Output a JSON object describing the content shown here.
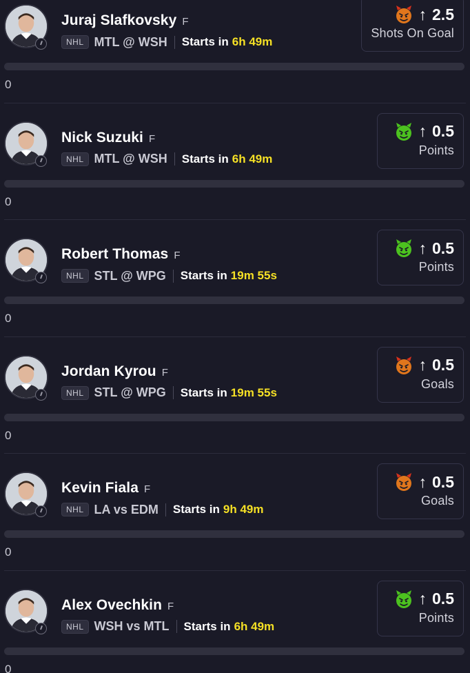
{
  "props": [
    {
      "player": "Juraj Slafkovsky",
      "position": "F",
      "league": "NHL",
      "matchup": "MTL @ WSH",
      "starts_label": "Starts in",
      "countdown": "6h 49m",
      "direction_icon": "arrow-up-icon",
      "line": "2.5",
      "stat": "Shots On Goal",
      "face": "devil-red-icon",
      "progress": 0,
      "progress_text": "0"
    },
    {
      "player": "Nick Suzuki",
      "position": "F",
      "league": "NHL",
      "matchup": "MTL @ WSH",
      "starts_label": "Starts in",
      "countdown": "6h 49m",
      "direction_icon": "arrow-up-icon",
      "line": "0.5",
      "stat": "Points",
      "face": "devil-green-icon",
      "progress": 0,
      "progress_text": "0"
    },
    {
      "player": "Robert Thomas",
      "position": "F",
      "league": "NHL",
      "matchup": "STL @ WPG",
      "starts_label": "Starts in",
      "countdown": "19m 55s",
      "direction_icon": "arrow-up-icon",
      "line": "0.5",
      "stat": "Points",
      "face": "devil-green-icon",
      "progress": 0,
      "progress_text": "0"
    },
    {
      "player": "Jordan Kyrou",
      "position": "F",
      "league": "NHL",
      "matchup": "STL @ WPG",
      "starts_label": "Starts in",
      "countdown": "19m 55s",
      "direction_icon": "arrow-up-icon",
      "line": "0.5",
      "stat": "Goals",
      "face": "devil-red-icon",
      "progress": 0,
      "progress_text": "0"
    },
    {
      "player": "Kevin Fiala",
      "position": "F",
      "league": "NHL",
      "matchup": "LA vs EDM",
      "starts_label": "Starts in",
      "countdown": "9h 49m",
      "direction_icon": "arrow-up-icon",
      "line": "0.5",
      "stat": "Goals",
      "face": "devil-red-icon",
      "progress": 0,
      "progress_text": "0"
    },
    {
      "player": "Alex Ovechkin",
      "position": "F",
      "league": "NHL",
      "matchup": "WSH vs MTL",
      "starts_label": "Starts in",
      "countdown": "6h 49m",
      "direction_icon": "arrow-up-icon",
      "line": "0.5",
      "stat": "Points",
      "face": "devil-green-icon",
      "progress": 0,
      "progress_text": "0"
    }
  ],
  "colors": {
    "background": "#1a1a27",
    "countdown": "#f5e025",
    "devil_red": "#d8321c",
    "devil_green": "#4cc21f",
    "track": "#30303e"
  }
}
